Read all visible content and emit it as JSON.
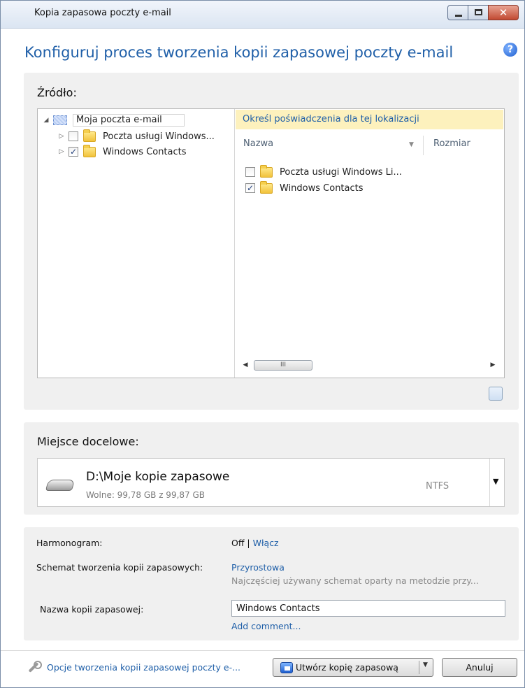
{
  "window": {
    "title": "Kopia zapasowa poczty e-mail",
    "close_glyph": "✕"
  },
  "header": {
    "title": "Konfiguruj proces tworzenia kopii zapasowej poczty e-mail",
    "help_glyph": "?"
  },
  "source": {
    "label": "Źródło:",
    "tree": {
      "root": {
        "label": "Moja poczta e-mail",
        "expander": "◢"
      },
      "items": [
        {
          "label": "Poczta usługi Windows...",
          "checked": false,
          "expander": "▷"
        },
        {
          "label": "Windows Contacts",
          "checked": true,
          "expander": "▷"
        }
      ]
    },
    "info_bar": "Określ poświadczenia dla tej lokalizacji",
    "columns": {
      "name": "Nazwa",
      "size": "Rozmiar",
      "sort_glyph": "▼"
    },
    "files": [
      {
        "label": "Poczta usługi Windows Li...",
        "checked": false
      },
      {
        "label": "Windows Contacts",
        "checked": true
      }
    ],
    "scroll": {
      "left": "◀",
      "right": "▶",
      "thumb_grip": "III"
    }
  },
  "destination": {
    "label": "Miejsce docelowe:",
    "path": "D:\\Moje kopie zapasowe",
    "free": "Wolne: 99,78 GB z 99,87 GB",
    "filesystem": "NTFS",
    "dropdown_glyph": "▼"
  },
  "options": {
    "schedule_label": "Harmonogram:",
    "schedule_value": "Off | ",
    "schedule_link": "Włącz",
    "scheme_label": "Schemat tworzenia kopii zapasowych:",
    "scheme_link": "Przyrostowa",
    "scheme_desc": "Najczęściej używany schemat oparty na metodzie przy...",
    "name_label": "Nazwa kopii zapasowej:",
    "name_value": "Windows Contacts",
    "add_comment": "Add comment..."
  },
  "footer": {
    "options_link": "Opcje tworzenia kopii zapasowej poczty e-...",
    "backup_button": "Utwórz kopię zapasową",
    "backup_arrow": "▼",
    "cancel_button": "Anuluj"
  },
  "colors": {
    "accent": "#1f5fa8",
    "info_bar": "#fdf1bd",
    "panel": "#f0f0f0"
  }
}
